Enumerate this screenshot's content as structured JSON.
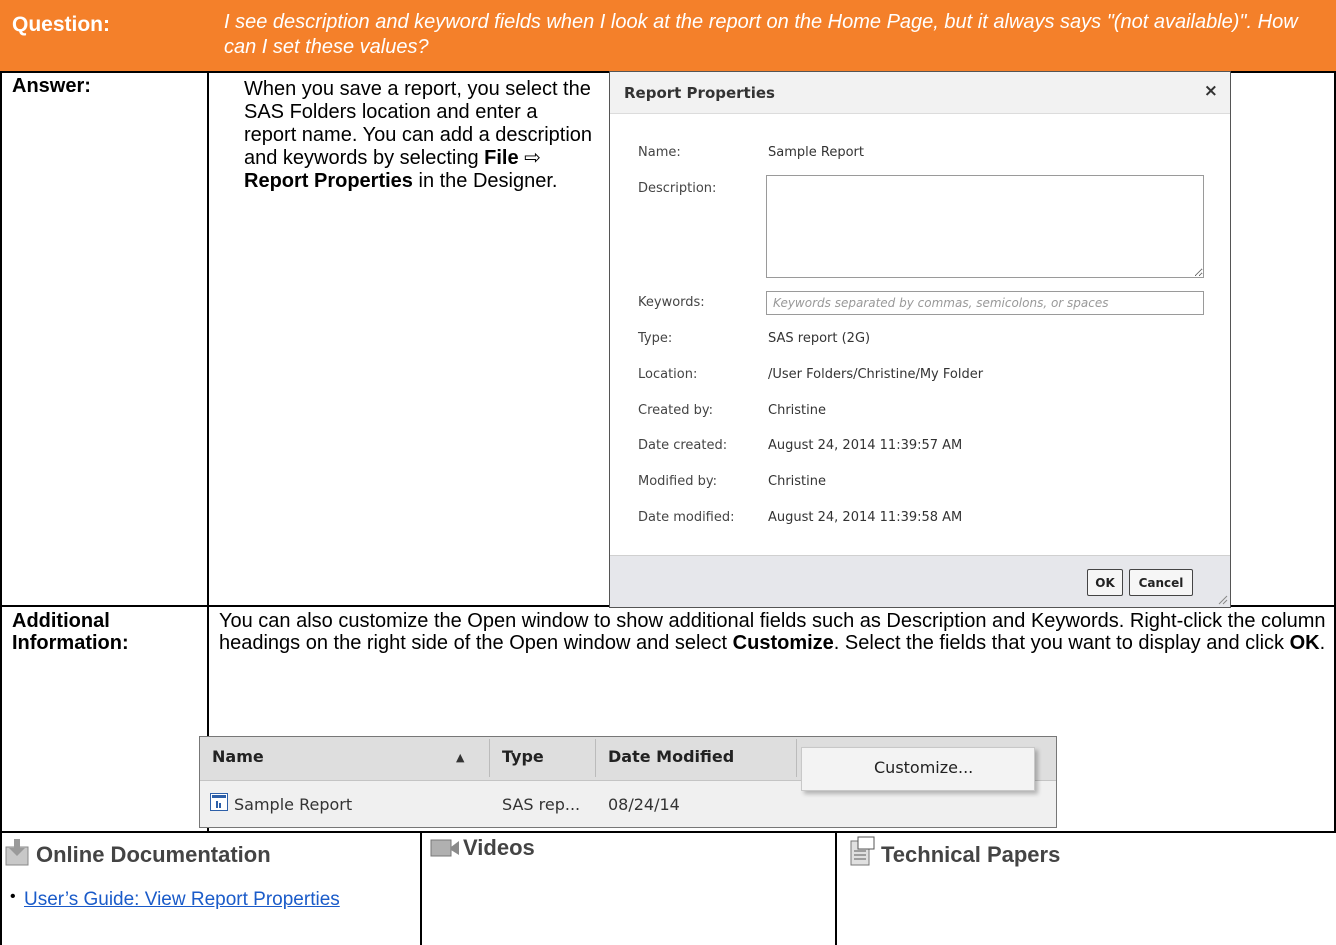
{
  "question": {
    "label": "Question:",
    "text": "I see description and keyword fields when I look at the report on the Home Page, but it always says \"(not available)\". How can I set these values?"
  },
  "answer": {
    "label": "Answer:",
    "text_1": "When you save a report, you select the SAS Folders location and enter a report name. You can add a description and keywords by selecting ",
    "menu_file": "File",
    "arrow": "⇨",
    "menu_report_properties": "Report Properties",
    "text_2": " in the Designer."
  },
  "dialog": {
    "title": "Report Properties",
    "close_glyph": "×",
    "name_label": "Name:",
    "name_value": "Sample Report",
    "description_label": "Description:",
    "description_value": "",
    "keywords_label": "Keywords:",
    "keywords_placeholder": "Keywords separated by commas, semicolons, or spaces",
    "type_label": "Type:",
    "type_value": "SAS report (2G)",
    "location_label": "Location:",
    "location_value": "/User Folders/Christine/My Folder",
    "created_by_label": "Created by:",
    "created_by_value": "Christine",
    "date_created_label": "Date created:",
    "date_created_value": "August 24, 2014 11:39:57 AM",
    "modified_by_label": "Modified by:",
    "modified_by_value": "Christine",
    "date_modified_label": "Date modified:",
    "date_modified_value": "August 24, 2014 11:39:58 AM",
    "ok_label": "OK",
    "cancel_label": "Cancel"
  },
  "additional": {
    "label_line1": "Additional",
    "label_line2": "Information:",
    "text_1": "You can also customize the Open window to show additional fields such as Description and Keywords.  Right-click the column headings on the right side of the Open window and select ",
    "customize_word": "Customize",
    "text_2": ". Select the fields that you want to display and click ",
    "ok_word": "OK",
    "text_3": "."
  },
  "open_window": {
    "col_name": "Name",
    "sort_glyph": "▲",
    "col_type": "Type",
    "col_date_modified": "Date Modified",
    "row_name": "Sample Report",
    "row_type": "SAS rep...",
    "row_date": "08/24/14",
    "context_menu_item": "Customize..."
  },
  "resources": {
    "online_docs_title": "Online Documentation",
    "online_docs_link": "User’s Guide: View Report Properties",
    "videos_title": "Videos",
    "technical_papers_title": "Technical Papers"
  },
  "colors": {
    "header_orange": "#f4802a",
    "dialog_footer": "#e6e7eb",
    "link_blue": "#1a5bc9"
  },
  "icons": [
    "report-icon",
    "download-document-icon",
    "video-camera-icon",
    "technical-paper-icon",
    "close-icon"
  ]
}
